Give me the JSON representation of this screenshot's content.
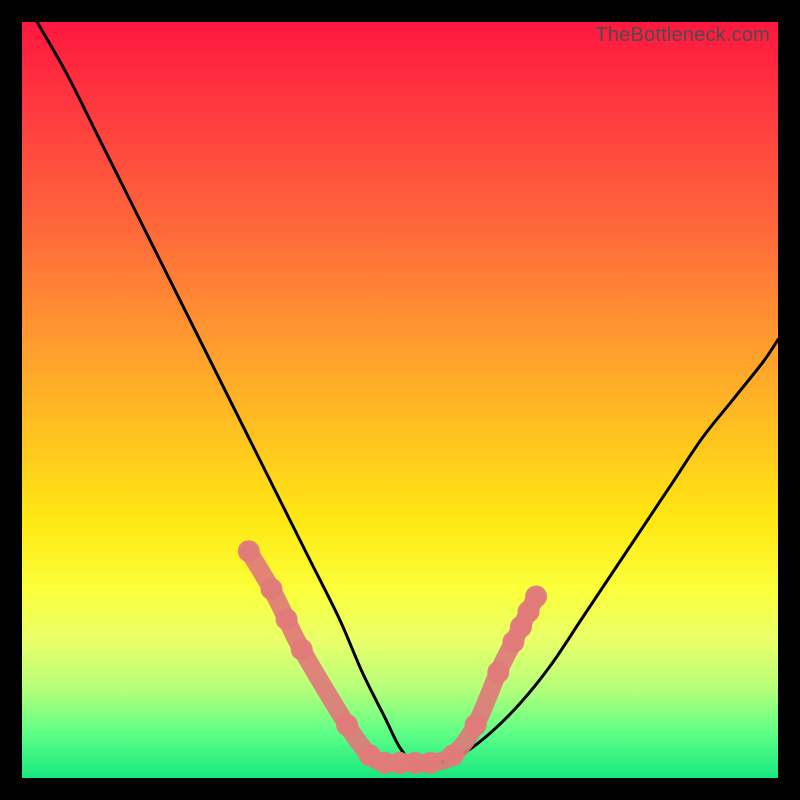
{
  "watermark": "TheBottleneck.com",
  "chart_data": {
    "type": "line",
    "title": "",
    "xlabel": "",
    "ylabel": "",
    "xlim": [
      0,
      100
    ],
    "ylim": [
      0,
      100
    ],
    "grid": false,
    "legend": false,
    "series": [
      {
        "name": "bottleneck-curve",
        "color": "#000000",
        "x": [
          2,
          6,
          10,
          14,
          18,
          22,
          26,
          30,
          34,
          38,
          42,
          45,
          48,
          50,
          52,
          55,
          58,
          62,
          66,
          70,
          74,
          78,
          82,
          86,
          90,
          94,
          98,
          100
        ],
        "y": [
          100,
          93,
          85,
          77,
          69,
          61,
          53,
          45,
          37,
          29,
          21,
          14,
          8,
          4,
          2,
          2,
          3,
          6,
          10,
          15,
          21,
          27,
          33,
          39,
          45,
          50,
          55,
          58
        ]
      }
    ],
    "markers": {
      "name": "highlighted-points",
      "color": "#e07a7a",
      "points": [
        {
          "x": 30,
          "y": 30
        },
        {
          "x": 33,
          "y": 25
        },
        {
          "x": 35,
          "y": 21
        },
        {
          "x": 37,
          "y": 17
        },
        {
          "x": 43,
          "y": 7
        },
        {
          "x": 46,
          "y": 3
        },
        {
          "x": 48,
          "y": 2
        },
        {
          "x": 50,
          "y": 2
        },
        {
          "x": 52,
          "y": 2
        },
        {
          "x": 54,
          "y": 2
        },
        {
          "x": 57,
          "y": 3
        },
        {
          "x": 60,
          "y": 7
        },
        {
          "x": 63,
          "y": 14
        },
        {
          "x": 65,
          "y": 18
        },
        {
          "x": 66,
          "y": 20
        },
        {
          "x": 67,
          "y": 22
        },
        {
          "x": 68,
          "y": 24
        }
      ]
    }
  }
}
